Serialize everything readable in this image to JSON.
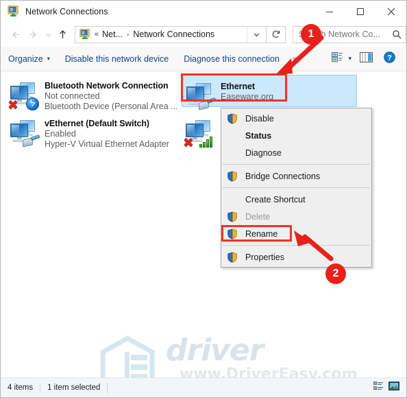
{
  "window": {
    "title": "Network Connections",
    "title_icon": "network-connections-icon",
    "minimize_label": "Minimize",
    "maximize_label": "Maximize",
    "close_label": "Close"
  },
  "nav": {
    "back_icon": "arrow-left-icon",
    "forward_icon": "arrow-right-icon",
    "recent_icon": "chevron-down-icon",
    "up_icon": "arrow-up-icon",
    "address_icon": "network-connections-icon",
    "overflow": "«",
    "crumb_1": "Net...",
    "crumb_sep": "›",
    "crumb_2": "Network Connections",
    "dropdown_icon": "chevron-down-icon",
    "refresh_icon": "refresh-icon",
    "search_placeholder": "Search Network Co...",
    "search_value": "",
    "search_icon": "search-icon"
  },
  "toolbar": {
    "organize": "Organize",
    "organize_caret": "▾",
    "disable_device": "Disable this network device",
    "diagnose_connection": "Diagnose this connection",
    "overflow": "»",
    "view_icon": "change-view-icon",
    "view_caret": "▾",
    "preview_pane_icon": "preview-pane-icon",
    "help_icon": "help-icon"
  },
  "connections": [
    {
      "name": "Bluetooth Network Connection",
      "status": "Not connected",
      "device": "Bluetooth Device (Personal Area ...",
      "icon": "network-adapter-icon",
      "overlay": "bluetooth-badge-icon",
      "disconnected": true,
      "selected": false
    },
    {
      "name": "vEthernet (Default Switch)",
      "status": "Enabled",
      "device": "Hyper-V Virtual Ethernet Adapter",
      "icon": "network-adapter-icon",
      "overlay": "rj45-cable-icon",
      "disconnected": false,
      "selected": false
    },
    {
      "name": "Ethernet",
      "status": "Easeware.org",
      "device": "",
      "icon": "network-adapter-icon",
      "overlay": "rj45-cable-icon",
      "disconnected": false,
      "selected": true
    },
    {
      "name": "",
      "status": "",
      "device": "",
      "icon": "network-adapter-icon",
      "overlay": "wifi-bars-icon",
      "disconnected": true,
      "selected": false
    }
  ],
  "context_menu": {
    "items": [
      {
        "label": "Disable",
        "shield": true,
        "bold": false,
        "disabled": false,
        "highlighted": false
      },
      {
        "label": "Status",
        "shield": false,
        "bold": true,
        "disabled": false,
        "highlighted": false
      },
      {
        "label": "Diagnose",
        "shield": false,
        "bold": false,
        "disabled": false,
        "highlighted": false
      },
      {
        "label": "Bridge Connections",
        "shield": true,
        "bold": false,
        "disabled": false,
        "highlighted": false
      },
      {
        "label": "Create Shortcut",
        "shield": false,
        "bold": false,
        "disabled": false,
        "highlighted": false
      },
      {
        "label": "Delete",
        "shield": true,
        "bold": false,
        "disabled": true,
        "highlighted": false
      },
      {
        "label": "Rename",
        "shield": true,
        "bold": false,
        "disabled": false,
        "highlighted": false
      },
      {
        "label": "Properties",
        "shield": true,
        "bold": false,
        "disabled": false,
        "highlighted": true
      }
    ]
  },
  "annotations": {
    "badge_1": "1",
    "badge_2": "2",
    "accent_color": "#e8211b",
    "highlight_color": "#f03228"
  },
  "watermark": {
    "brand": "driver easy",
    "url": "www.DriverEasy.com",
    "logo_icon": "driver-easy-logo-icon"
  },
  "statusbar": {
    "item_count": "4 items",
    "selection": "1 item selected",
    "details_view_icon": "details-view-icon",
    "tiles_view_icon": "tiles-view-icon"
  }
}
